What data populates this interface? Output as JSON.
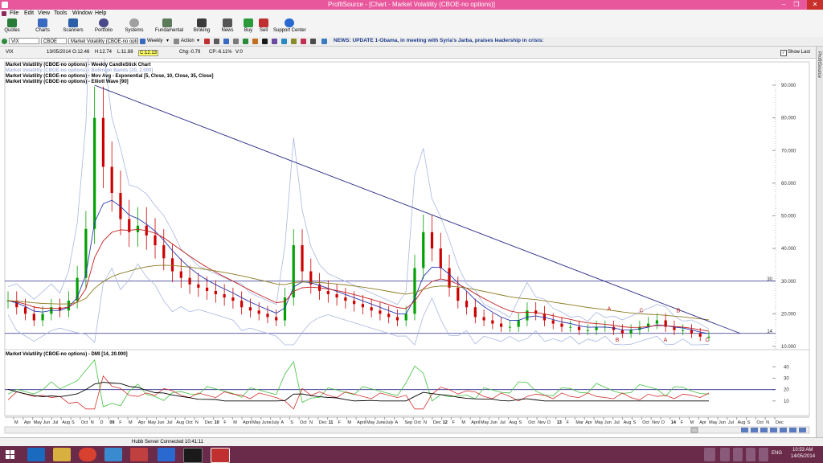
{
  "window": {
    "title": "ProfitSource - [Chart - Market Volatility (CBOE-no options)]"
  },
  "menu": [
    "File",
    "Edit",
    "View",
    "Tools",
    "Window",
    "Help"
  ],
  "toolbar": [
    {
      "label": "Quotes",
      "color": "#2a7a3a"
    },
    {
      "label": "Charts",
      "color": "#3a6ac0"
    },
    {
      "label": "Scanners",
      "color": "#2b5fa8"
    },
    {
      "label": "Portfolio",
      "color": "#4a4a8a"
    },
    {
      "label": "Systems",
      "color": "#a0a0a0"
    },
    {
      "label": "Fundamental",
      "color": "#5a7a5a"
    },
    {
      "label": "Broking",
      "color": "#3a3a3a"
    },
    {
      "label": "News",
      "color": "#555555"
    },
    {
      "label": "Buy",
      "color": "#2a9a3a"
    },
    {
      "label": "Sell",
      "color": "#c03030"
    },
    {
      "label": "Support Center",
      "color": "#2a6ad0"
    }
  ],
  "chart_toolbar": {
    "symbol": "VIX",
    "exchange": "CBOE",
    "name": "Market Volatility (CBOE-no option",
    "period": "Weekly",
    "action": "Action",
    "news": "NEWS: UPDATE 1-Obama, in meeting with Syria's Jarba, praises leadership in crisis:"
  },
  "info": {
    "symbol": "VIX",
    "date": "13/05/2014",
    "open": "O:12.46",
    "high": "H:12.74",
    "low": "L:11.88",
    "close": "C:12.13",
    "chg": "Chg:-0.79",
    "cp": "CP:-6.11%",
    "volume": "V:0",
    "show_last": "Show Last"
  },
  "side_tab": "ProfitSource",
  "legend": [
    {
      "text": "Market Volatility (CBOE-no options) - Weekly CandleStick Chart",
      "color": "#000000"
    },
    {
      "text": "Market Volatility (CBOE-no options) - Bollinger Bands [20, 2.000]",
      "color": "#aab8e0"
    },
    {
      "text": "Market Volatility (CBOE-no options) - Mov Avg - Exponential [5, Close, 10, Close, 35, Close]",
      "color": "#000000"
    },
    {
      "text": "Market Volatility (CBOE-no options) - Elliott Wave [90]",
      "color": "#000000"
    }
  ],
  "dmi_legend": "Market Volatility (CBOE-no options) - DMI [14, 20.000]",
  "price_axis": [
    "90.000",
    "80.000",
    "70.000",
    "60.000",
    "50.000",
    "40.000",
    "30.000",
    "20.000",
    "10.000"
  ],
  "dmi_axis": [
    "40",
    "30",
    "20",
    "10"
  ],
  "markers": {
    "line30": "30",
    "line14": "14"
  },
  "wave_labels": [
    "A",
    "B",
    "C",
    "B",
    "A",
    "C"
  ],
  "date_axis": [
    "M",
    "Apr",
    "May",
    "Jun",
    "Jul",
    "Aug",
    "S",
    "Oct",
    "N",
    "D",
    "09",
    "F",
    "M",
    "Apr",
    "May",
    "Jun",
    "Jul",
    "Aug",
    "Oct",
    "N",
    "Dec",
    "10",
    "F",
    "M",
    "April",
    "May",
    "June",
    "July",
    "A",
    "S",
    "Oct",
    "N",
    "Dec",
    "11",
    "F",
    "M",
    "April",
    "May",
    "June",
    "July",
    "A",
    "Sep",
    "Oct",
    "N",
    "Dec",
    "12",
    "F",
    "M",
    "April",
    "May",
    "Jun",
    "Jul",
    "Aug",
    "S",
    "Oct",
    "Nov",
    "D",
    "13",
    "F",
    "Mar",
    "Apr",
    "May",
    "Jun",
    "Jul",
    "Aug",
    "S",
    "Oct",
    "Nov",
    "D",
    "14",
    "F",
    "M",
    "Apr",
    "May",
    "Jun",
    "Jul",
    "Aug",
    "S",
    "Oct",
    "N",
    "Dec"
  ],
  "status": "Hubb Server Connected 10:41:11",
  "clock": {
    "time": "10:53 AM",
    "date": "14/05/2014",
    "lang": "ENG"
  },
  "colors": {
    "title_bar": "#e8569c",
    "taskbar": "#6a2a4a",
    "up_candle": "#00a000",
    "down_candle": "#cc0000",
    "trendline": "#2a2a8a"
  },
  "chart_data": {
    "type": "candlestick",
    "title": "Market Volatility (CBOE-no options) - Weekly CandleStick Chart",
    "ylim": [
      10,
      90
    ],
    "y_ticks": [
      10,
      20,
      30,
      40,
      50,
      60,
      70,
      80,
      90
    ],
    "horizontal_lines": [
      30,
      14
    ],
    "closes": [
      24,
      22,
      20,
      18,
      20,
      22,
      21,
      24,
      31,
      46,
      80,
      65,
      57,
      49,
      45,
      47,
      44,
      41,
      37,
      33,
      31,
      29,
      28,
      27,
      26,
      25,
      24,
      22,
      21,
      20,
      19,
      18,
      25,
      41,
      33,
      29,
      27,
      26,
      25,
      24,
      23,
      22,
      21,
      20,
      19,
      18,
      20,
      34,
      45,
      40,
      34,
      28,
      24,
      22,
      19,
      18,
      17,
      16,
      16,
      18,
      21,
      20,
      18,
      17,
      16,
      16,
      15,
      15,
      16,
      16,
      15,
      14,
      15,
      16,
      17,
      18,
      16,
      15,
      15,
      14,
      13,
      13
    ],
    "dmi_y_ticks": [
      10,
      20,
      30,
      40
    ],
    "dmi_level": 20
  }
}
